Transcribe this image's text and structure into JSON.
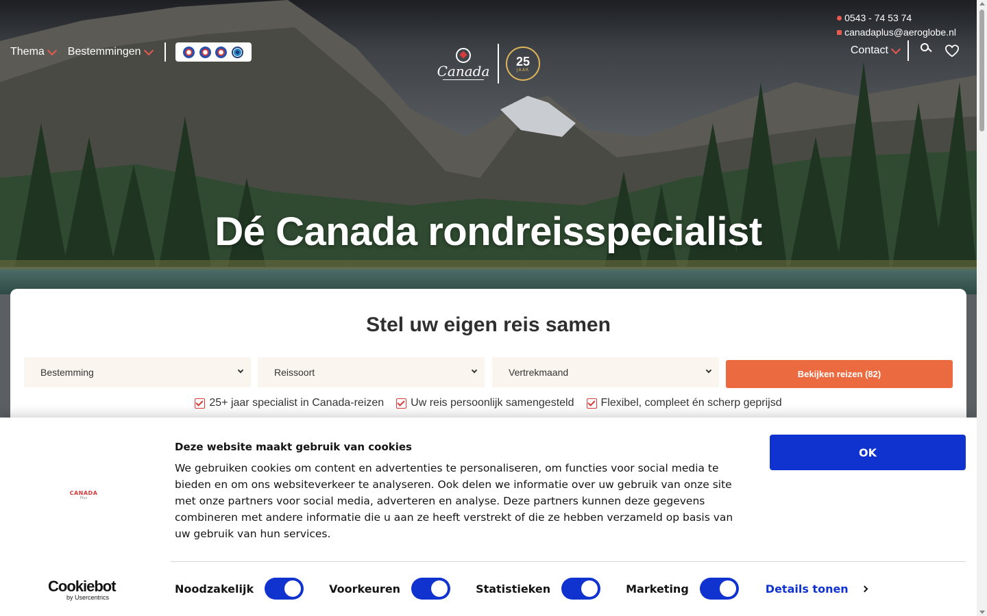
{
  "nav": {
    "left_items": [
      {
        "label": "Thema"
      },
      {
        "label": "Bestemmingen"
      }
    ],
    "contact_label": "Contact"
  },
  "contact": {
    "phone": "0543 - 74 53 74",
    "email": "canadaplus@aeroglobe.nl"
  },
  "logo": {
    "brand": "Canada",
    "anniversary_number": "25",
    "anniversary_word": "JAAR"
  },
  "hero": {
    "title": "Dé Canada rondreisspecialist"
  },
  "search": {
    "title": "Stel uw eigen reis samen",
    "destination": "Bestemming",
    "trip_type": "Reissoort",
    "departure_month": "Vertrekmaand",
    "cta": "Bekijken reizen (82)",
    "usps": [
      "25+ jaar specialist in Canada-reizen",
      "Uw reis persoonlijk samengesteld",
      "Flexibel, compleet én scherp geprijsd"
    ]
  },
  "cookie": {
    "logo_text": "CANADA",
    "logo_sub": "Plus",
    "heading": "Deze website maakt gebruik van cookies",
    "body": "We gebruiken cookies om content en advertenties te personaliseren, om functies voor social media te bieden en om ons websiteverkeer te analyseren. Ook delen we informatie over uw gebruik van onze site met onze partners voor social media, adverteren en analyse. Deze partners kunnen deze gegevens combineren met andere informatie die u aan ze heeft verstrekt of die ze hebben verzameld op basis van uw gebruik van hun services.",
    "ok": "OK",
    "cookiebot": "Cookiebot",
    "cookiebot_by": "by Usercentrics",
    "toggles": [
      {
        "label": "Noodzakelijk",
        "on": true
      },
      {
        "label": "Voorkeuren",
        "on": true
      },
      {
        "label": "Statistieken",
        "on": true
      },
      {
        "label": "Marketing",
        "on": true
      }
    ],
    "details": "Details tonen"
  },
  "colors": {
    "accent": "#ec6a40",
    "cookie_blue": "#1032cf",
    "check_red": "#d93a3a"
  }
}
